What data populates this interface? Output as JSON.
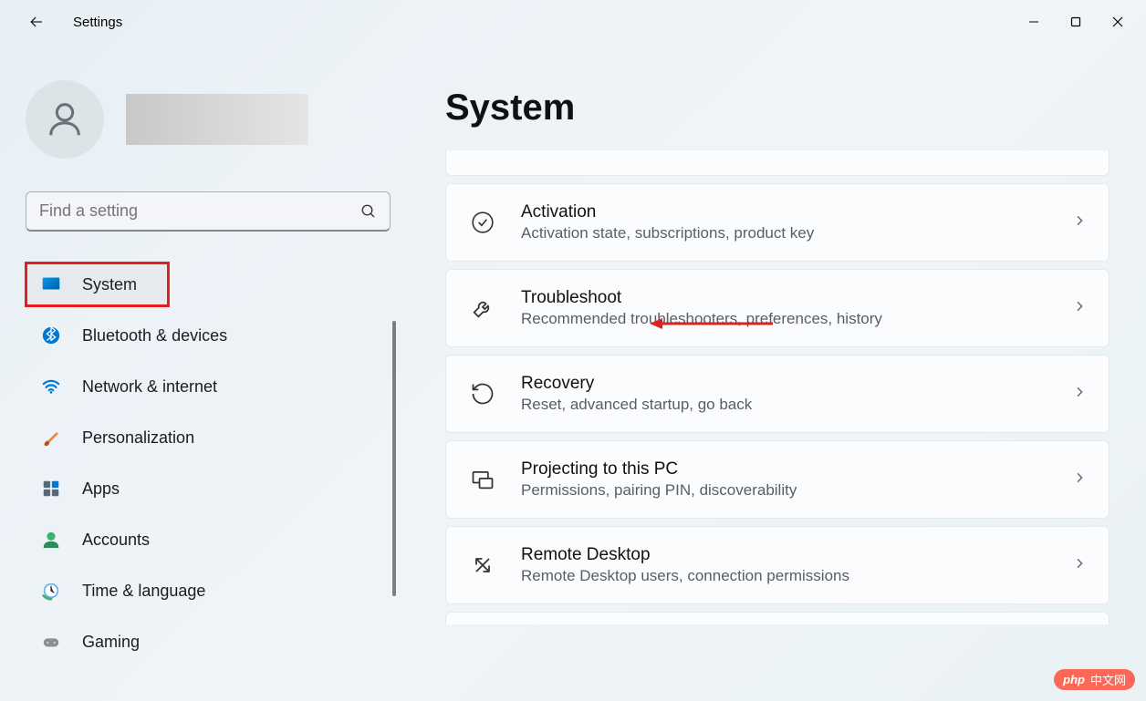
{
  "app": {
    "title": "Settings"
  },
  "search": {
    "placeholder": "Find a setting"
  },
  "sidebar": {
    "items": [
      {
        "label": "System",
        "active": true,
        "highlighted": true
      },
      {
        "label": "Bluetooth & devices"
      },
      {
        "label": "Network & internet"
      },
      {
        "label": "Personalization"
      },
      {
        "label": "Apps"
      },
      {
        "label": "Accounts"
      },
      {
        "label": "Time & language"
      },
      {
        "label": "Gaming"
      }
    ]
  },
  "main": {
    "title": "System",
    "cards": [
      {
        "title": "Activation",
        "subtitle": "Activation state, subscriptions, product key"
      },
      {
        "title": "Troubleshoot",
        "subtitle": "Recommended troubleshooters, preferences, history"
      },
      {
        "title": "Recovery",
        "subtitle": "Reset, advanced startup, go back"
      },
      {
        "title": "Projecting to this PC",
        "subtitle": "Permissions, pairing PIN, discoverability"
      },
      {
        "title": "Remote Desktop",
        "subtitle": "Remote Desktop users, connection permissions"
      }
    ]
  },
  "watermark": {
    "text": "中文网"
  }
}
